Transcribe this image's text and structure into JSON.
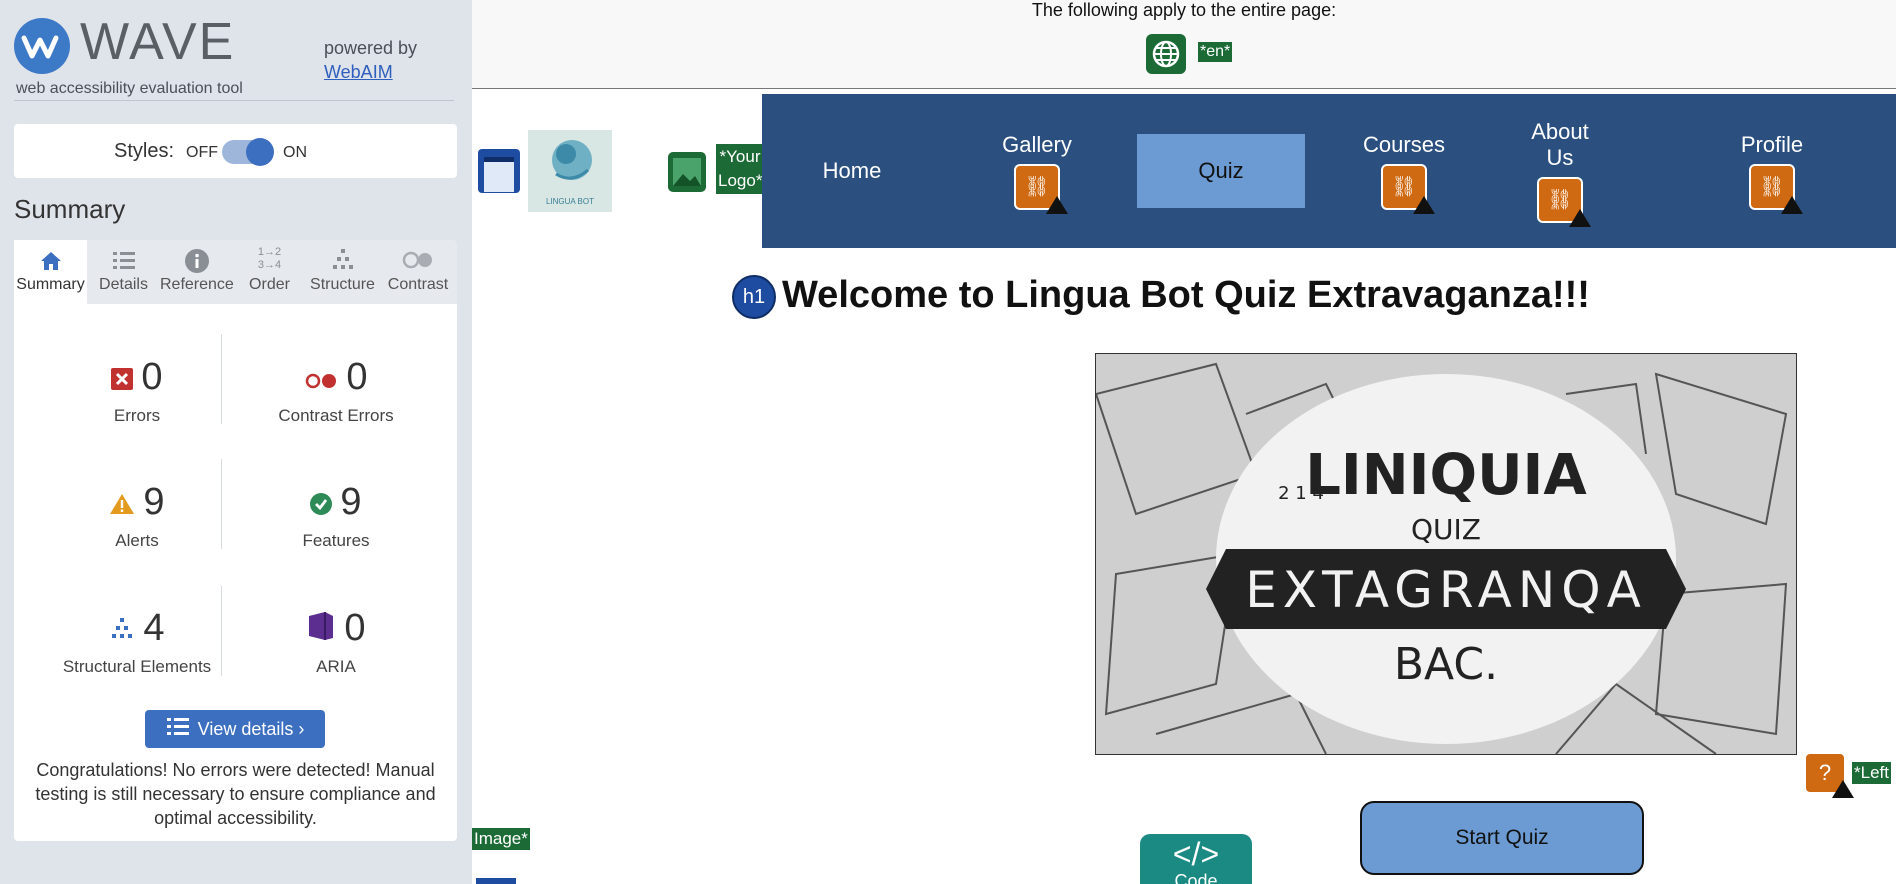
{
  "sidebar": {
    "logo_text": "WAVE",
    "tagline": "web accessibility evaluation tool",
    "powered_by": "powered by",
    "webaim_link": "WebAIM",
    "styles_label": "Styles:",
    "styles_off": "OFF",
    "styles_on": "ON",
    "summary_heading": "Summary",
    "tabs": [
      {
        "label": "Summary",
        "icon": "home-icon"
      },
      {
        "label": "Details",
        "icon": "list-icon"
      },
      {
        "label": "Reference",
        "icon": "info-icon"
      },
      {
        "label": "Order",
        "icon": "order-icon"
      },
      {
        "label": "Structure",
        "icon": "structure-icon"
      },
      {
        "label": "Contrast",
        "icon": "contrast-icon"
      }
    ],
    "stats": {
      "errors": {
        "count": "0",
        "label": "Errors"
      },
      "contrast_errors": {
        "count": "0",
        "label": "Contrast Errors"
      },
      "alerts": {
        "count": "9",
        "label": "Alerts"
      },
      "features": {
        "count": "9",
        "label": "Features"
      },
      "structural": {
        "count": "4",
        "label": "Structural Elements"
      },
      "aria": {
        "count": "0",
        "label": "ARIA"
      }
    },
    "view_details": "View details ›",
    "congrats": "Congratulations! No errors were detected! Manual testing is still necessary to ensure compliance and optimal accessibility."
  },
  "main": {
    "page_apply_text": "The following apply to the entire page:",
    "lang_label": "*en*",
    "logo_label": "*Your Logo*",
    "brand_text": "LINGUA BOT",
    "nav": [
      {
        "label": "Home"
      },
      {
        "label": "Gallery"
      },
      {
        "label": "Quiz"
      },
      {
        "label": "Courses"
      },
      {
        "label": "About Us"
      },
      {
        "label": "Profile"
      }
    ],
    "h1_badge": "h1",
    "heading": "Welcome to Lingua Bot Quiz Extravaganza!!!",
    "hero_lines": [
      "LINIQUIA",
      "QUIZ",
      "EXTAGRANQA",
      "BAC."
    ],
    "hero_number": "2 1 4",
    "left_label": "*Left",
    "image_label": "Image*",
    "start_quiz": "Start Quiz",
    "code_label": "Code",
    "code_glyph": "</>",
    "alert_glyph": "?"
  },
  "colors": {
    "nav_bg": "#2b5080",
    "nav_active": "#6b9bd2",
    "wave_blue": "#3c6fc0",
    "feature_green": "#1c6b36",
    "alert_orange": "#d06a12"
  }
}
